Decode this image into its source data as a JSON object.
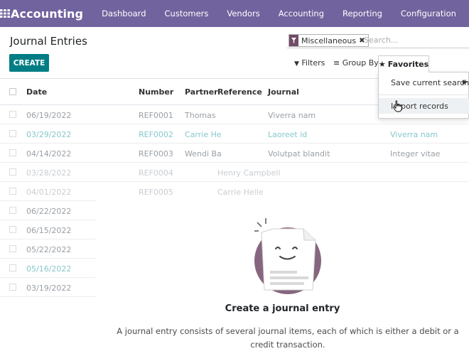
{
  "navbar": {
    "brand": "Accounting",
    "menu": [
      "Dashboard",
      "Customers",
      "Vendors",
      "Accounting",
      "Reporting",
      "Configuration"
    ]
  },
  "page": {
    "title": "Journal Entries",
    "create_label": "CREATE"
  },
  "search": {
    "facet_label": "Miscellaneous",
    "placeholder": "Search..."
  },
  "toolbar": {
    "filters_label": "Filters",
    "groupby_label": "Group By",
    "favorites_label": "Favorites"
  },
  "favorites_menu": {
    "save_label": "Save current search",
    "import_label": "Import records"
  },
  "table": {
    "headers": {
      "date": "Date",
      "number": "Number",
      "partner": "Partner",
      "reference": "Reference",
      "journal": "Journal"
    },
    "rows": [
      {
        "date": "06/19/2022",
        "number": "REF0001",
        "partner": "Thomas",
        "reference": "",
        "journal": "Viverra nam",
        "extra": "",
        "extra2": ""
      },
      {
        "date": "03/29/2022",
        "number": "REF0002",
        "partner": "Carrie He",
        "reference": "",
        "journal": "Laoreet id",
        "extra": "Viverra nam",
        "extra2": ""
      },
      {
        "date": "04/14/2022",
        "number": "REF0003",
        "partner": "Wendi Ba",
        "reference": "",
        "journal": "Volutpat blandit",
        "extra": "Integer vitae",
        "extra2": ""
      },
      {
        "date": "03/28/2022",
        "number": "REF0004",
        "partner": "",
        "reference": "Henry Campbell",
        "journal": "",
        "extra": "",
        "extra2": ""
      },
      {
        "date": "04/01/2022",
        "number": "REF0005",
        "partner": "",
        "reference": "Carrie Helle",
        "journal": "",
        "extra": "",
        "extra2": ""
      },
      {
        "date": "06/22/2022",
        "number": "",
        "partner": "",
        "reference": "",
        "journal": "",
        "extra": "",
        "extra2": ""
      },
      {
        "date": "06/15/2022",
        "number": "",
        "partner": "",
        "reference": "",
        "journal": "",
        "extra": "",
        "extra2": ""
      },
      {
        "date": "05/22/2022",
        "number": "",
        "partner": "",
        "reference": "",
        "journal": "",
        "extra": "",
        "extra2": ""
      },
      {
        "date": "05/16/2022",
        "number": "",
        "partner": "",
        "reference": "",
        "journal": "",
        "extra": "",
        "extra2": ""
      },
      {
        "date": "03/19/2022",
        "number": "",
        "partner": "",
        "reference": "",
        "journal": "",
        "extra": "",
        "extra2": ""
      }
    ]
  },
  "empty_state": {
    "title": "Create a journal entry",
    "text": "A journal entry consists of several journal items, each of which is either a debit or a credit transaction."
  },
  "colors": {
    "navbar": "#71639e",
    "primary": "#017e84",
    "facet": "#714b67",
    "illustration": "#714b67"
  }
}
